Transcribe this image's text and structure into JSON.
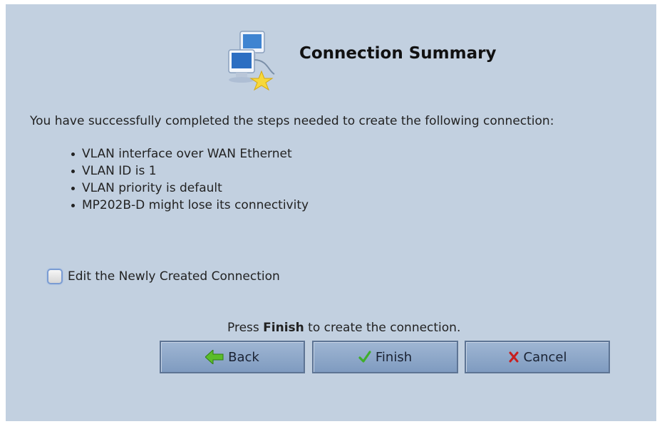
{
  "header": {
    "title": "Connection Summary",
    "icon": "network-computers-star-icon"
  },
  "summary": {
    "intro": "You have successfully completed the steps needed to create the following connection:",
    "items": [
      "VLAN interface over WAN Ethernet",
      "VLAN ID is 1",
      "VLAN priority is default",
      "MP202B-D might lose its connectivity"
    ]
  },
  "edit_option": {
    "label": "Edit the Newly Created Connection",
    "checked": false
  },
  "instruction": {
    "prefix": "Press ",
    "emphasis": "Finish",
    "suffix": " to create the connection."
  },
  "buttons": {
    "back": {
      "label": "Back",
      "icon": "back-arrow-icon"
    },
    "finish": {
      "label": "Finish",
      "icon": "checkmark-icon"
    },
    "cancel": {
      "label": "Cancel",
      "icon": "red-x-icon"
    }
  },
  "colors": {
    "panel_background": "#c2d0e0",
    "button_fill": "#8ea8ca",
    "back_icon": "#5bbd2a",
    "finish_icon": "#3fae2a",
    "cancel_icon": "#c81f1f"
  }
}
